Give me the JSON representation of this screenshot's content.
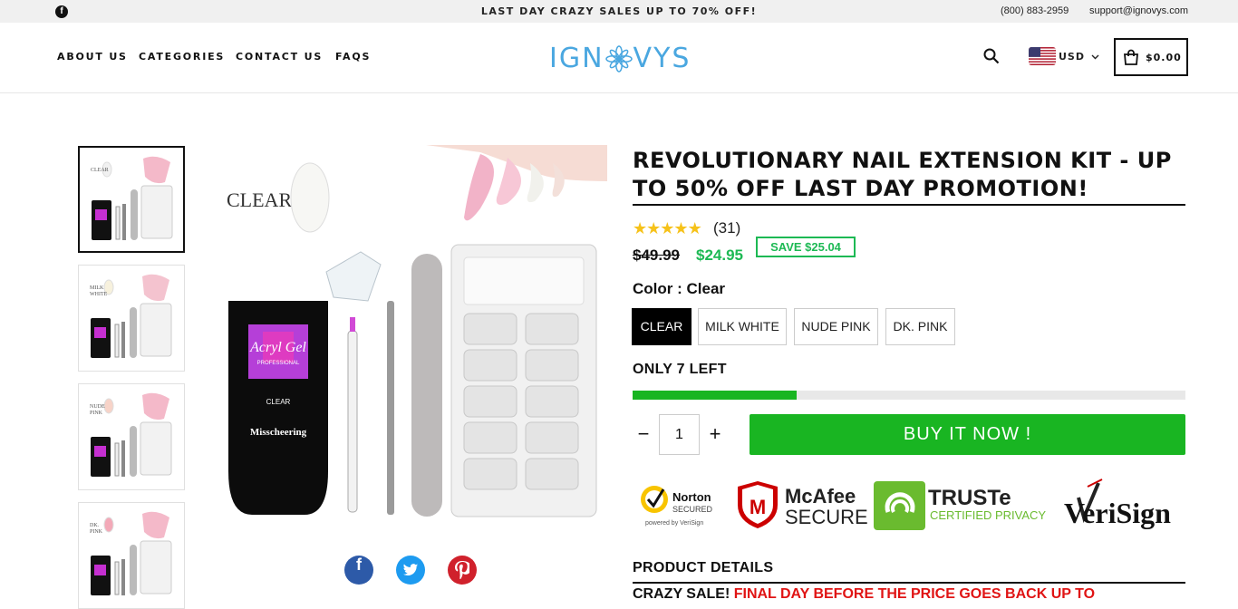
{
  "topbar": {
    "announcement": "LAST DAY CRAZY SALES UP TO 70% OFF!",
    "phone": "(800) 883-2959",
    "email": "support@ignovys.com",
    "social_icon": "facebook-icon"
  },
  "header": {
    "nav": [
      "ABOUT US",
      "CATEGORIES",
      "CONTACT US",
      "FAQS"
    ],
    "logo_left": "IGN",
    "logo_right": "VYS",
    "currency": "USD",
    "cart_total": "$0.00"
  },
  "gallery": {
    "thumbnails": [
      {
        "label": "CLEAR",
        "active": true
      },
      {
        "label": "MILK WHITE",
        "active": false
      },
      {
        "label": "NUDE PINK",
        "active": false
      },
      {
        "label": "DK. PINK",
        "active": false
      }
    ],
    "main_label": "CLEAR",
    "tube_brand": "Acryl Gel",
    "tube_sub": "PROFESSIONAL",
    "tube_shade": "CLEAR",
    "tube_maker": "Misscheering",
    "share_icons": [
      "facebook-icon",
      "twitter-icon",
      "pinterest-icon"
    ]
  },
  "product": {
    "title": "REVOLUTIONARY NAIL EXTENSION KIT - UP TO 50% OFF LAST DAY PROMOTION!",
    "rating": 5,
    "reviews": "(31)",
    "old_price": "$49.99",
    "new_price": "$24.95",
    "save_badge": "SAVE $25.04",
    "color_label": "Color : Clear",
    "colors": [
      "CLEAR",
      "MILK WHITE",
      "NUDE PINK",
      "DK. PINK"
    ],
    "selected_color": "CLEAR",
    "stock_label": "ONLY 7 LEFT",
    "stock_fraction": 0.297,
    "quantity": "1",
    "buy_button": "BUY IT NOW !",
    "trust_badges": [
      "Norton SECURED",
      "McAfee SECURE",
      "TRUSTe CERTIFIED PRIVACY",
      "VeriSign"
    ],
    "norton_top": "Norton",
    "norton_mid": "SECURED",
    "norton_bottom": "powered by VeriSign",
    "mcafee_top": "McAfee",
    "mcafee_bottom": "SECURE",
    "truste_top": "TRUSTe",
    "truste_bottom": "CERTIFIED PRIVACY",
    "verisign": "VeriSign",
    "details_title": "PRODUCT DETAILS",
    "details_text_black": "CRAZY SALE! ",
    "details_text_red": "FINAL DAY BEFORE THE PRICE GOES BACK UP TO"
  },
  "colors": {
    "accent_green": "#19b522",
    "logo_blue": "#4aa7e0",
    "sale_red": "#e01414",
    "star_yellow": "#f6c21a"
  }
}
